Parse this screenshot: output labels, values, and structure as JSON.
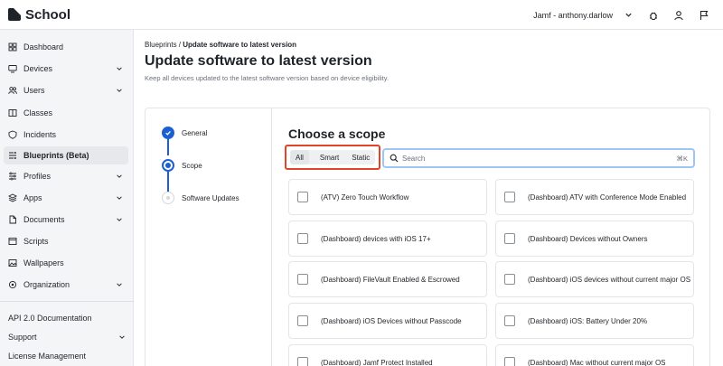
{
  "app": {
    "name": "School"
  },
  "topbar": {
    "user": "Jamf - anthony.darlow",
    "icons": [
      "chevron-down-icon",
      "bug-icon",
      "user-icon",
      "flag-icon"
    ]
  },
  "sidebar": {
    "items": [
      {
        "label": "Dashboard",
        "icon": "dashboard-icon",
        "chevron": false
      },
      {
        "label": "Devices",
        "icon": "monitor-icon",
        "chevron": true
      },
      {
        "label": "Users",
        "icon": "users-icon",
        "chevron": true
      },
      {
        "label": "Classes",
        "icon": "classes-icon",
        "chevron": false
      },
      {
        "label": "Incidents",
        "icon": "incidents-icon",
        "chevron": false
      },
      {
        "label": "Blueprints (Beta)",
        "icon": "blueprints-icon",
        "chevron": false,
        "active": true
      },
      {
        "label": "Profiles",
        "icon": "profiles-icon",
        "chevron": true
      },
      {
        "label": "Apps",
        "icon": "apps-icon",
        "chevron": true
      },
      {
        "label": "Documents",
        "icon": "document-icon",
        "chevron": true
      },
      {
        "label": "Scripts",
        "icon": "scripts-icon",
        "chevron": false
      },
      {
        "label": "Wallpapers",
        "icon": "image-icon",
        "chevron": false
      },
      {
        "label": "Organization",
        "icon": "gear-icon",
        "chevron": true
      }
    ],
    "bottom_links": [
      {
        "label": "API 2.0 Documentation"
      },
      {
        "label": "Support",
        "chevron": true
      },
      {
        "label": "License Management"
      }
    ]
  },
  "breadcrumb": {
    "parent": "Blueprints",
    "separator": " / ",
    "current": "Update software to latest version"
  },
  "page": {
    "title": "Update software to latest version",
    "subtitle": "Keep all devices updated to the latest software version based on device eligibility."
  },
  "steps": [
    {
      "label": "General",
      "state": "done"
    },
    {
      "label": "Scope",
      "state": "current"
    },
    {
      "label": "Software Updates",
      "state": "todo"
    }
  ],
  "scope": {
    "title": "Choose a scope",
    "filters": [
      {
        "label": "All",
        "active": true
      },
      {
        "label": "Smart",
        "active": false
      },
      {
        "label": "Static",
        "active": false
      }
    ],
    "search": {
      "placeholder": "Search",
      "value": "",
      "shortcut": "⌘K"
    },
    "groups": [
      "(ATV) Zero Touch Workflow",
      "(Dashboard) ATV with Conference Mode Enabled",
      "(Dashboard) devices with iOS 17+",
      "(Dashboard) Devices without Owners",
      "(Dashboard) FileVault Enabled & Escrowed",
      "(Dashboard) iOS devices without current major OS",
      "(Dashboard) iOS Devices without Passcode",
      "(Dashboard) iOS: Battery Under 20%",
      "(Dashboard) Jamf Protect Installed",
      "(Dashboard) Mac without current major OS"
    ]
  },
  "colors": {
    "accent": "#1b5fd1",
    "highlight_box": "#e0452a",
    "search_focus": "#9ec5f5"
  }
}
